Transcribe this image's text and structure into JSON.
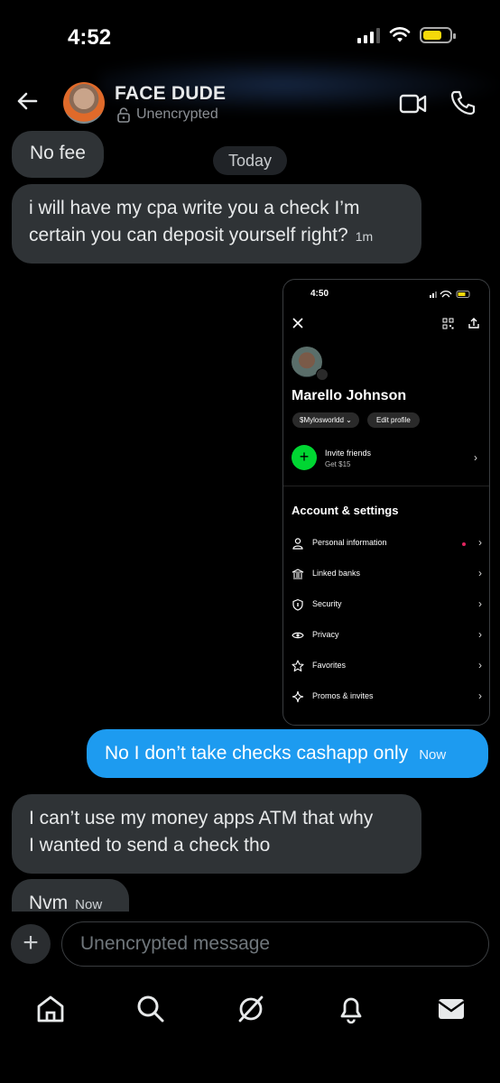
{
  "status_bar": {
    "time": "4:52"
  },
  "header": {
    "contact_name": "FACE DUDE",
    "encryption_status": "Unencrypted",
    "icons": [
      "back-arrow-icon",
      "avatar",
      "lock-icon",
      "video-call-icon",
      "phone-icon"
    ]
  },
  "messages": {
    "msg1": {
      "text": "No fee"
    },
    "day_separator": "Today",
    "msg2": {
      "line1": "i will have my cpa write you a check I’m",
      "line2": "certain you can deposit yourself right?",
      "time": "1m"
    },
    "msg3": {
      "text": "No I don’t take checks cashapp only",
      "time": "Now"
    },
    "msg4": {
      "line1": "I can’t use my money apps ATM that why",
      "line2": "I wanted to send a check tho"
    },
    "msg5": {
      "text": "Nvm",
      "time": "Now"
    }
  },
  "attachment": {
    "time": "4:50",
    "profile_name": "Marello Johnson",
    "cashtag": "$Mylosworldd",
    "edit_profile": "Edit profile",
    "invite_title": "Invite friends",
    "invite_sub": "Get $15",
    "section_title": "Account & settings",
    "items": [
      {
        "label": "Personal information",
        "icon": "person-icon"
      },
      {
        "label": "Linked banks",
        "icon": "bank-icon"
      },
      {
        "label": "Security",
        "icon": "shield-icon"
      },
      {
        "label": "Privacy",
        "icon": "eye-icon"
      },
      {
        "label": "Favorites",
        "icon": "star-icon"
      },
      {
        "label": "Promos & invites",
        "icon": "sparkle-icon"
      }
    ],
    "colors": {
      "invite_green": "#00d632",
      "alert_dot": "#e0245e"
    }
  },
  "composer": {
    "placeholder": "Unencrypted message"
  },
  "tabbar": {
    "icons": [
      "home-icon",
      "search-icon",
      "grok-icon",
      "notifications-icon",
      "messages-icon"
    ]
  },
  "colors": {
    "outgoing_bubble": "#1d9bf0",
    "incoming_bubble": "#2f3336",
    "background": "#000000"
  }
}
